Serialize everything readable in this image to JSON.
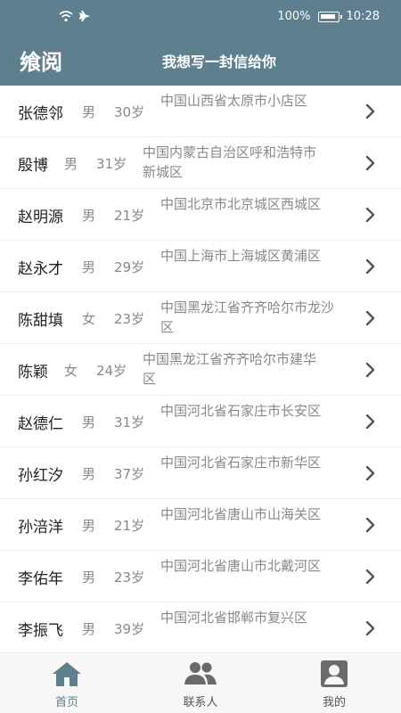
{
  "status_bar": {
    "battery": "100%",
    "time": "10:28"
  },
  "app_bar": {
    "title": "飨阅",
    "subtitle": "我想写一封信给你"
  },
  "contacts": [
    {
      "name": "张德邻",
      "gender": "男",
      "age": "30岁",
      "address": "中国山西省太原市小店区"
    },
    {
      "name": "殷博",
      "gender": "男",
      "age": "31岁",
      "address": "中国内蒙古自治区呼和浩特市新城区"
    },
    {
      "name": "赵明源",
      "gender": "男",
      "age": "21岁",
      "address": "中国北京市北京城区西城区"
    },
    {
      "name": "赵永才",
      "gender": "男",
      "age": "29岁",
      "address": "中国上海市上海城区黄浦区"
    },
    {
      "name": "陈甜填",
      "gender": "女",
      "age": "23岁",
      "address": "中国黑龙江省齐齐哈尔市龙沙区"
    },
    {
      "name": "陈颖",
      "gender": "女",
      "age": "24岁",
      "address": "中国黑龙江省齐齐哈尔市建华区"
    },
    {
      "name": "赵德仁",
      "gender": "男",
      "age": "31岁",
      "address": "中国河北省石家庄市长安区"
    },
    {
      "name": "孙红汐",
      "gender": "男",
      "age": "37岁",
      "address": "中国河北省石家庄市新华区"
    },
    {
      "name": "孙涪洋",
      "gender": "男",
      "age": "21岁",
      "address": "中国河北省唐山市山海关区"
    },
    {
      "name": "李佑年",
      "gender": "男",
      "age": "23岁",
      "address": "中国河北省唐山市北戴河区"
    },
    {
      "name": "李振飞",
      "gender": "男",
      "age": "39岁",
      "address": "中国河北省邯郸市复兴区"
    }
  ],
  "tabs": [
    {
      "label": "首页",
      "icon": "home-icon",
      "active": true
    },
    {
      "label": "联系人",
      "icon": "contacts-icon",
      "active": false
    },
    {
      "label": "我的",
      "icon": "profile-icon",
      "active": false
    }
  ],
  "colors": {
    "primary": "#5e7f8d",
    "text_secondary": "#888888"
  }
}
